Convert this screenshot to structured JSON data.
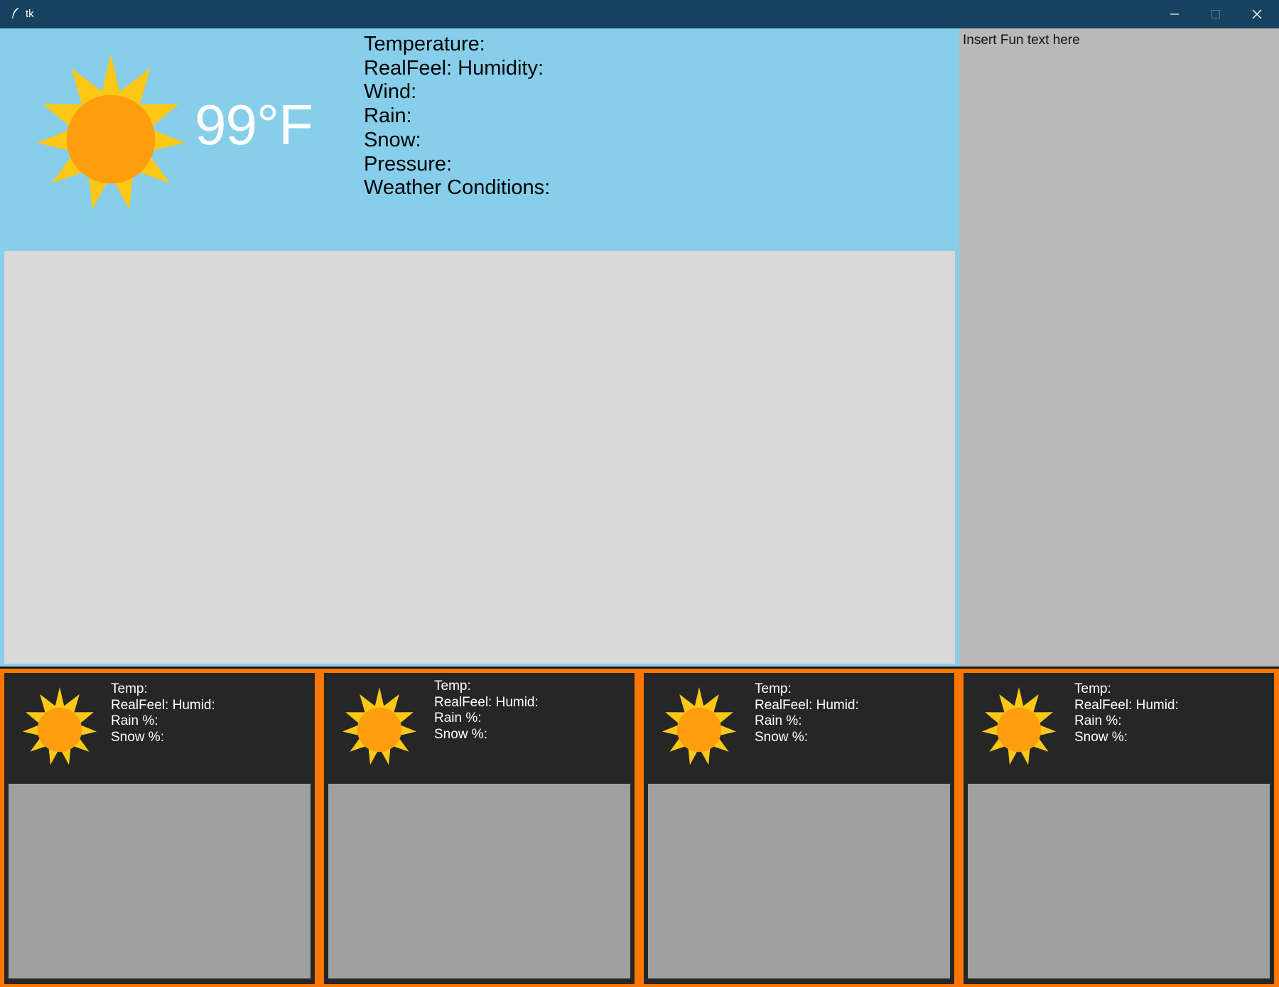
{
  "window": {
    "title": "tk"
  },
  "current": {
    "temperature_display": "99°F",
    "condition_icon": "sun-icon",
    "labels": {
      "temperature": "Temperature:",
      "realfeel_humidity": "RealFeel:  Humidity:",
      "wind": "Wind:",
      "rain": "Rain:",
      "snow": "Snow:",
      "pressure": "Pressure:",
      "conditions": "Weather Conditions:"
    }
  },
  "sidebar": {
    "text": "Insert Fun text here"
  },
  "forecast": [
    {
      "icon": "sun-icon",
      "temp": "Temp:",
      "realfeel_humid": "RealFeel:  Humid:",
      "rain": "Rain %:",
      "snow": "Snow %:"
    },
    {
      "icon": "sun-icon",
      "temp": "Temp:",
      "realfeel_humid": "RealFeel:  Humid:",
      "rain": "Rain %:",
      "snow": "Snow %:"
    },
    {
      "icon": "sun-icon",
      "temp": "Temp:",
      "realfeel_humid": "RealFeel:  Humid:",
      "rain": "Rain %:",
      "snow": "Snow %:"
    },
    {
      "icon": "sun-icon",
      "temp": "Temp:",
      "realfeel_humid": "RealFeel:  Humid:",
      "rain": "Rain %:",
      "snow": "Snow %:"
    }
  ],
  "colors": {
    "titlebar": "#17425f",
    "current_panel": "#87ceea",
    "main_canvas": "#d9d9d9",
    "sidebar": "#b9b9b9",
    "forecast_border": "#ff7700",
    "forecast_card": "#262626",
    "forecast_canvas": "#a0a0a0",
    "sun_rays": "#fcc816",
    "sun_core": "#fe9e0f"
  }
}
